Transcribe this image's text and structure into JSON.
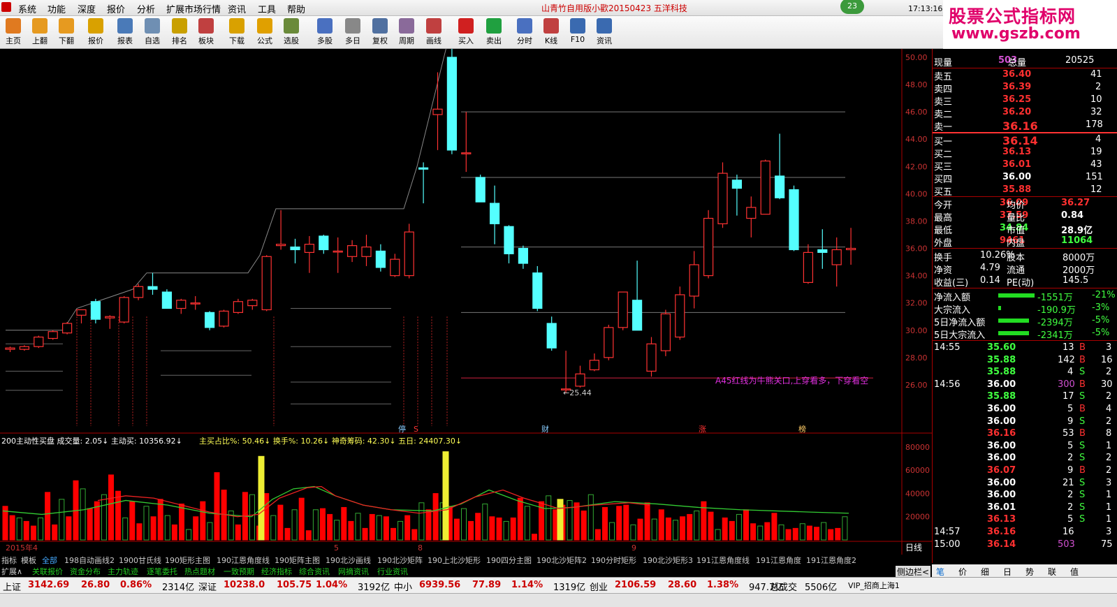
{
  "app": {
    "title": "山青竹自用版小歡20150423  五洋科技",
    "badge": "23",
    "clock": "17:13:16 周四"
  },
  "menu": [
    "系统",
    "功能",
    "深度",
    "报价",
    "分析",
    "扩展市场行情",
    "资讯",
    "工具",
    "帮助"
  ],
  "toolbar": [
    {
      "label": "主页",
      "icon": "home-icon",
      "color": "#e07a20"
    },
    {
      "label": "上翻",
      "icon": "arrow-up-icon",
      "color": "#e69a20"
    },
    {
      "label": "下翻",
      "icon": "arrow-down-icon",
      "color": "#e69a20"
    },
    {
      "label": "报价",
      "icon": "quote-icon",
      "color": "#d9a100"
    },
    {
      "label": "报表",
      "icon": "report-icon",
      "color": "#4a7ab8"
    },
    {
      "label": "自选",
      "icon": "f6-icon",
      "color": "#6f8fb3"
    },
    {
      "label": "排名",
      "icon": "rank-icon",
      "color": "#c9a000"
    },
    {
      "label": "板块",
      "icon": "sector-icon",
      "color": "#c04040"
    },
    {
      "label": "下载",
      "icon": "download-icon",
      "color": "#d9a100"
    },
    {
      "label": "公式",
      "icon": "formula-icon",
      "color": "#e0a000"
    },
    {
      "label": "选股",
      "icon": "stock-pick-icon",
      "color": "#6a8a3a"
    },
    {
      "label": "多股",
      "icon": "multi-stock-icon",
      "color": "#4a70c0"
    },
    {
      "label": "多日",
      "icon": "multi-day-icon",
      "color": "#888888"
    },
    {
      "label": "复权",
      "icon": "adjust-icon",
      "color": "#5070a0"
    },
    {
      "label": "周期",
      "icon": "f8-icon",
      "color": "#8a6a9a"
    },
    {
      "label": "画线",
      "icon": "draw-line-icon",
      "color": "#c04040"
    },
    {
      "label": "买入",
      "icon": "buy-icon",
      "color": "#d02020"
    },
    {
      "label": "卖出",
      "icon": "sell-icon",
      "color": "#20a040"
    },
    {
      "label": "分时",
      "icon": "intraday-icon",
      "color": "#4a70c0"
    },
    {
      "label": "K线",
      "icon": "kline-icon",
      "color": "#c04040"
    },
    {
      "label": "F10",
      "icon": "f10-icon",
      "color": "#3a6ab0"
    },
    {
      "label": "资讯",
      "icon": "news-icon",
      "color": "#3a6ab0"
    }
  ],
  "brand": {
    "line1": "股票公式指标网",
    "line2": "www.gszb.com"
  },
  "chart_data": {
    "type": "candlestick",
    "ylim": [
      24,
      50
    ],
    "price_ticks": [
      "50.00",
      "48.00",
      "46.00",
      "44.00",
      "42.00",
      "40.00",
      "38.00",
      "36.00",
      "34.00",
      "32.00",
      "30.00",
      "28.00",
      "26.00"
    ],
    "annotations": {
      "high": "50.95",
      "low": "25.44",
      "note": "A45红线为牛熊关口,上穿看多，下穿看空",
      "markers": [
        "停",
        "S",
        "财",
        "涨",
        "榜"
      ]
    },
    "candles": [
      [
        28.6,
        28.8,
        28.4,
        28.7
      ],
      [
        28.6,
        28.9,
        28.5,
        28.8
      ],
      [
        28.8,
        29.6,
        28.7,
        29.5
      ],
      [
        29.4,
        30.0,
        29.3,
        29.9
      ],
      [
        29.8,
        30.6,
        29.7,
        30.5
      ],
      [
        31.1,
        31.5,
        30.5,
        31.5
      ],
      [
        32.1,
        32.3,
        30.5,
        30.8
      ],
      [
        30.9,
        31.1,
        30.1,
        31.0
      ],
      [
        30.6,
        32.5,
        30.5,
        32.4
      ],
      [
        32.4,
        33.4,
        32.2,
        33.2
      ],
      [
        33.2,
        34.2,
        32.6,
        33.0
      ],
      [
        32.8,
        33.0,
        31.6,
        31.6
      ],
      [
        31.6,
        32.3,
        31.2,
        32.2
      ],
      [
        32.0,
        32.5,
        31.5,
        32.0
      ],
      [
        31.3,
        31.4,
        30.0,
        30.2
      ],
      [
        30.3,
        31.5,
        30.2,
        31.4
      ],
      [
        31.3,
        32.3,
        31.2,
        32.1
      ],
      [
        31.8,
        32.3,
        31.5,
        32.2
      ],
      [
        31.5,
        35.5,
        31.4,
        35.4
      ],
      [
        36.2,
        38.8,
        35.9,
        36.3
      ],
      [
        36.1,
        36.7,
        34.9,
        35.9
      ],
      [
        35.7,
        36.9,
        34.2,
        36.3
      ],
      [
        36.9,
        37.0,
        35.6,
        35.9
      ],
      [
        35.8,
        36.8,
        34.2,
        35.8
      ],
      [
        35.4,
        36.6,
        35.0,
        36.2
      ],
      [
        35.4,
        37.0,
        34.7,
        36.1
      ],
      [
        35.8,
        36.3,
        34.3,
        34.6
      ],
      [
        34.0,
        35.6,
        33.9,
        35.2
      ],
      [
        34.0,
        37.8,
        33.8,
        37.2
      ],
      [
        41.9,
        42.3,
        39.3,
        41.8
      ],
      [
        45.8,
        48.9,
        43.2,
        46.2
      ],
      [
        50.0,
        50.95,
        42.9,
        43.2
      ],
      [
        43.0,
        46.0,
        41.6,
        43.0
      ],
      [
        41.2,
        41.4,
        39.6,
        39.4
      ],
      [
        39.3,
        40.6,
        36.3,
        37.8
      ],
      [
        37.6,
        37.7,
        34.9,
        35.6
      ],
      [
        36.0,
        36.2,
        34.5,
        34.9
      ],
      [
        34.2,
        34.7,
        31.4,
        31.6
      ],
      [
        30.5,
        31.0,
        28.5,
        28.7
      ],
      [
        25.7,
        28.5,
        25.4,
        25.7
      ],
      [
        25.9,
        27.4,
        25.8,
        26.8
      ],
      [
        27.1,
        28.3,
        27.0,
        27.8
      ],
      [
        28.0,
        30.4,
        27.8,
        30.2
      ],
      [
        30.2,
        32.1,
        30.0,
        32.8
      ],
      [
        32.2,
        35.1,
        30.0,
        30.0
      ],
      [
        27.0,
        29.5,
        26.6,
        29.0
      ],
      [
        28.5,
        31.5,
        28.1,
        31.2
      ],
      [
        29.5,
        33.2,
        29.3,
        32.6
      ],
      [
        32.5,
        35.8,
        31.6,
        34.8
      ],
      [
        34.0,
        38.8,
        33.8,
        38.2
      ],
      [
        37.8,
        42.3,
        37.5,
        41.5
      ],
      [
        41.0,
        41.4,
        38.4,
        40.4
      ],
      [
        38.2,
        39.8,
        36.8,
        39.0
      ],
      [
        38.5,
        42.5,
        38.5,
        42.4
      ],
      [
        41.3,
        44.4,
        39.6,
        39.7
      ],
      [
        40.3,
        40.6,
        35.8,
        35.9
      ],
      [
        33.5,
        36.3,
        33.4,
        35.7
      ],
      [
        35.9,
        37.4,
        34.5,
        35.7
      ],
      [
        34.8,
        36.8,
        33.2,
        35.9
      ],
      [
        35.9,
        37.5,
        34.8,
        36.0
      ]
    ],
    "volumes": [
      2.9,
      2.1,
      1.9,
      1.6,
      1.2,
      1.9,
      4.1,
      1.3,
      3.5,
      2.0,
      5.1,
      4.4,
      2.7,
      3.3,
      3.9,
      5.6,
      4.2,
      1.9,
      3.3,
      1.4,
      2.9,
      2.0,
      3.5,
      2.1,
      1.3,
      3.1,
      0.9,
      2.0,
      3.3,
      1.5,
      5.8,
      4.3,
      2.5,
      1.3,
      4.1,
      3.9,
      1.2,
      4.0,
      2.1,
      3.0,
      1.0,
      2.6,
      3.6,
      0.8,
      2.6,
      2.7,
      2.2,
      1.7,
      2.8,
      1.6,
      2.3,
      1.0,
      2.2,
      2.1,
      2.0,
      1.0,
      1.6,
      2.1,
      0.9,
      3.2,
      2.6,
      4.0,
      3.2,
      2.9,
      1.8,
      2.7,
      1.6,
      2.3,
      3.1,
      2.0,
      1.9,
      1.6,
      1.9,
      3.6,
      2.9,
      0.5,
      3.3,
      3.8,
      2.6,
      3.0,
      3.4,
      3.2,
      2.5,
      3.9,
      0.9,
      2.8,
      1.5,
      2.9,
      3.0,
      1.3,
      1.8,
      3.2,
      1.8,
      2.6,
      1.9,
      1.7,
      2.0,
      2.2,
      2.5,
      3.3,
      2.4,
      0.9,
      1.9,
      1.6,
      2.2,
      2.6,
      1.4,
      1.2,
      1.5,
      2.3,
      1.3,
      0.9,
      1.0,
      1.4,
      1.2,
      1.1,
      1.5,
      0.9,
      1.0,
      2.0
    ],
    "vol_ticks": [
      "80000",
      "60000",
      "40000",
      "20000"
    ],
    "date_labels": [
      {
        "text": "2015年4"
      },
      {
        "text": "5"
      },
      {
        "text": "8"
      },
      {
        "text": "9"
      }
    ],
    "kline_label": "日线"
  },
  "indicator_line": "200主动性买盘  成交量: 2.05↓  主动买: 10356.92↓",
  "indicator_line2": "主买占比%: 50.46↓  换手%: 10.26↓  神奇筹码: 42.30↓  五日: 24407.30↓",
  "quote": {
    "now_label": "现量",
    "now": "503",
    "total_label": "总量",
    "total": "20525",
    "sells": [
      {
        "l": "卖五",
        "p": "36.40",
        "v": "41"
      },
      {
        "l": "卖四",
        "p": "36.39",
        "v": "2"
      },
      {
        "l": "卖三",
        "p": "36.25",
        "v": "10"
      },
      {
        "l": "卖二",
        "p": "36.20",
        "v": "32"
      },
      {
        "l": "卖一",
        "p": "36.16",
        "v": "178"
      }
    ],
    "buys": [
      {
        "l": "买一",
        "p": "36.14",
        "v": "4"
      },
      {
        "l": "买二",
        "p": "36.13",
        "v": "19"
      },
      {
        "l": "买三",
        "p": "36.01",
        "v": "43"
      },
      {
        "l": "买四",
        "p": "36.00",
        "v": "151"
      },
      {
        "l": "买五",
        "p": "35.88",
        "v": "12"
      }
    ],
    "stats": [
      {
        "l": "今开",
        "v": "36.09",
        "l2": "均价",
        "v2": "36.27"
      },
      {
        "l": "最高",
        "v": "37.59",
        "l2": "量比",
        "v2": "0.84"
      },
      {
        "l": "最低",
        "v": "34.84",
        "l2": "市值",
        "v2": "28.9亿"
      },
      {
        "l": "外盘",
        "v": "9461",
        "l2": "内盘",
        "v2": "11064"
      }
    ],
    "stats2": [
      {
        "l": "换手",
        "v": "10.26%",
        "l2": "股本",
        "v2": "8000万"
      },
      {
        "l": "净资",
        "v": "4.79",
        "l2": "流通",
        "v2": "2000万"
      },
      {
        "l": "收益(三)",
        "v": "0.14",
        "l2": "PE(动)",
        "v2": "145.5"
      }
    ],
    "flows": [
      {
        "l": "净流入额",
        "v": "-1551万",
        "p": "-21%"
      },
      {
        "l": "大宗流入",
        "v": "-190.9万",
        "p": "-3%"
      },
      {
        "l": "5日净流入额",
        "v": "-2394万",
        "p": "-5%"
      },
      {
        "l": "5日大宗流入",
        "v": "-2341万",
        "p": "-5%"
      }
    ],
    "ticks": [
      {
        "t": "14:55",
        "p": "35.60",
        "v": "13",
        "s": "B",
        "n": "3"
      },
      {
        "t": "",
        "p": "35.88",
        "v": "142",
        "s": "B",
        "n": "16"
      },
      {
        "t": "",
        "p": "35.88",
        "v": "4",
        "s": "S",
        "n": "2"
      },
      {
        "t": "14:56",
        "p": "36.00",
        "v": "300",
        "s": "B",
        "n": "30"
      },
      {
        "t": "",
        "p": "35.88",
        "v": "17",
        "s": "S",
        "n": "2"
      },
      {
        "t": "",
        "p": "36.00",
        "v": "5",
        "s": "B",
        "n": "4"
      },
      {
        "t": "",
        "p": "36.00",
        "v": "9",
        "s": "S",
        "n": "2"
      },
      {
        "t": "",
        "p": "36.16",
        "v": "53",
        "s": "B",
        "n": "8"
      },
      {
        "t": "",
        "p": "36.00",
        "v": "5",
        "s": "S",
        "n": "1"
      },
      {
        "t": "",
        "p": "36.00",
        "v": "2",
        "s": "S",
        "n": "2"
      },
      {
        "t": "",
        "p": "36.07",
        "v": "9",
        "s": "B",
        "n": "2"
      },
      {
        "t": "",
        "p": "36.00",
        "v": "21",
        "s": "S",
        "n": "3"
      },
      {
        "t": "",
        "p": "36.00",
        "v": "2",
        "s": "S",
        "n": "1"
      },
      {
        "t": "",
        "p": "36.01",
        "v": "2",
        "s": "S",
        "n": "1"
      },
      {
        "t": "",
        "p": "36.13",
        "v": "5",
        "s": "S",
        "n": "1"
      },
      {
        "t": "14:57",
        "p": "36.16",
        "v": "16",
        "s": "",
        "n": "3"
      },
      {
        "t": "15:00",
        "p": "36.14",
        "v": "503",
        "s": "",
        "n": "75"
      }
    ]
  },
  "tabs": [
    "指标",
    "模板",
    "全部",
    "198自动画线2",
    "1900甘氏线",
    "190矩形主图",
    "190江恩角度线",
    "190矩阵主图",
    "190北沙画线",
    "190北沙矩阵",
    "190上北沙矩形",
    "190四分主图",
    "190北沙矩阵2",
    "190分时矩形",
    "190北沙矩形3",
    "191江恩角度线",
    "191江恩角度",
    "191江恩角度2"
  ],
  "tabs2": [
    "扩展∧",
    "关联报价",
    "资金分布",
    "主力轨迹",
    "逐笔委托",
    "热点题材",
    "一致预期",
    "经济指标",
    "综合资讯",
    "网摘资讯",
    "行业资讯"
  ],
  "right_tabs": [
    "笔",
    "价",
    "细",
    "日",
    "势",
    "联",
    "值"
  ],
  "sidebar_label": "侧边栏<",
  "status": [
    {
      "name": "上证",
      "v": "3142.69",
      "c": "26.80",
      "p": "0.86%",
      "a": "2314亿"
    },
    {
      "name": "深证",
      "v": "10238.0",
      "c": "105.75",
      "p": "1.04%",
      "a": "3192亿"
    },
    {
      "name": "中小",
      "v": "6939.56",
      "c": "77.89",
      "p": "1.14%",
      "a": "1319亿"
    },
    {
      "name": "创业",
      "v": "2106.59",
      "c": "28.60",
      "p": "1.38%",
      "a": "947.7亿"
    }
  ],
  "status_total_label": "总成交",
  "status_total": "5506亿",
  "status_right": "VIP_招商上海1"
}
